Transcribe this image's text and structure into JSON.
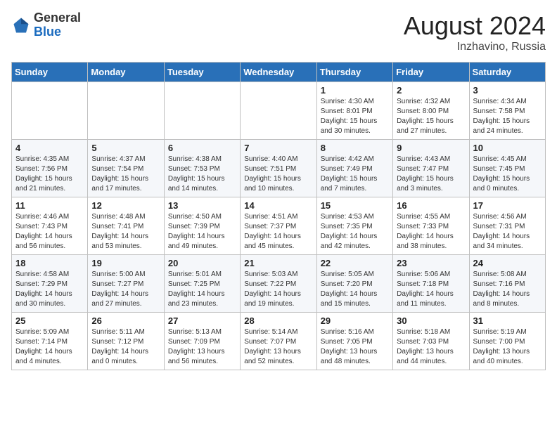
{
  "header": {
    "logo_general": "General",
    "logo_blue": "Blue",
    "month_title": "August 2024",
    "location": "Inzhavino, Russia"
  },
  "days_of_week": [
    "Sunday",
    "Monday",
    "Tuesday",
    "Wednesday",
    "Thursday",
    "Friday",
    "Saturday"
  ],
  "weeks": [
    {
      "days": [
        {
          "num": "",
          "info": ""
        },
        {
          "num": "",
          "info": ""
        },
        {
          "num": "",
          "info": ""
        },
        {
          "num": "",
          "info": ""
        },
        {
          "num": "1",
          "info": "Sunrise: 4:30 AM\nSunset: 8:01 PM\nDaylight: 15 hours\nand 30 minutes."
        },
        {
          "num": "2",
          "info": "Sunrise: 4:32 AM\nSunset: 8:00 PM\nDaylight: 15 hours\nand 27 minutes."
        },
        {
          "num": "3",
          "info": "Sunrise: 4:34 AM\nSunset: 7:58 PM\nDaylight: 15 hours\nand 24 minutes."
        }
      ]
    },
    {
      "days": [
        {
          "num": "4",
          "info": "Sunrise: 4:35 AM\nSunset: 7:56 PM\nDaylight: 15 hours\nand 21 minutes."
        },
        {
          "num": "5",
          "info": "Sunrise: 4:37 AM\nSunset: 7:54 PM\nDaylight: 15 hours\nand 17 minutes."
        },
        {
          "num": "6",
          "info": "Sunrise: 4:38 AM\nSunset: 7:53 PM\nDaylight: 15 hours\nand 14 minutes."
        },
        {
          "num": "7",
          "info": "Sunrise: 4:40 AM\nSunset: 7:51 PM\nDaylight: 15 hours\nand 10 minutes."
        },
        {
          "num": "8",
          "info": "Sunrise: 4:42 AM\nSunset: 7:49 PM\nDaylight: 15 hours\nand 7 minutes."
        },
        {
          "num": "9",
          "info": "Sunrise: 4:43 AM\nSunset: 7:47 PM\nDaylight: 15 hours\nand 3 minutes."
        },
        {
          "num": "10",
          "info": "Sunrise: 4:45 AM\nSunset: 7:45 PM\nDaylight: 15 hours\nand 0 minutes."
        }
      ]
    },
    {
      "days": [
        {
          "num": "11",
          "info": "Sunrise: 4:46 AM\nSunset: 7:43 PM\nDaylight: 14 hours\nand 56 minutes."
        },
        {
          "num": "12",
          "info": "Sunrise: 4:48 AM\nSunset: 7:41 PM\nDaylight: 14 hours\nand 53 minutes."
        },
        {
          "num": "13",
          "info": "Sunrise: 4:50 AM\nSunset: 7:39 PM\nDaylight: 14 hours\nand 49 minutes."
        },
        {
          "num": "14",
          "info": "Sunrise: 4:51 AM\nSunset: 7:37 PM\nDaylight: 14 hours\nand 45 minutes."
        },
        {
          "num": "15",
          "info": "Sunrise: 4:53 AM\nSunset: 7:35 PM\nDaylight: 14 hours\nand 42 minutes."
        },
        {
          "num": "16",
          "info": "Sunrise: 4:55 AM\nSunset: 7:33 PM\nDaylight: 14 hours\nand 38 minutes."
        },
        {
          "num": "17",
          "info": "Sunrise: 4:56 AM\nSunset: 7:31 PM\nDaylight: 14 hours\nand 34 minutes."
        }
      ]
    },
    {
      "days": [
        {
          "num": "18",
          "info": "Sunrise: 4:58 AM\nSunset: 7:29 PM\nDaylight: 14 hours\nand 30 minutes."
        },
        {
          "num": "19",
          "info": "Sunrise: 5:00 AM\nSunset: 7:27 PM\nDaylight: 14 hours\nand 27 minutes."
        },
        {
          "num": "20",
          "info": "Sunrise: 5:01 AM\nSunset: 7:25 PM\nDaylight: 14 hours\nand 23 minutes."
        },
        {
          "num": "21",
          "info": "Sunrise: 5:03 AM\nSunset: 7:22 PM\nDaylight: 14 hours\nand 19 minutes."
        },
        {
          "num": "22",
          "info": "Sunrise: 5:05 AM\nSunset: 7:20 PM\nDaylight: 14 hours\nand 15 minutes."
        },
        {
          "num": "23",
          "info": "Sunrise: 5:06 AM\nSunset: 7:18 PM\nDaylight: 14 hours\nand 11 minutes."
        },
        {
          "num": "24",
          "info": "Sunrise: 5:08 AM\nSunset: 7:16 PM\nDaylight: 14 hours\nand 8 minutes."
        }
      ]
    },
    {
      "days": [
        {
          "num": "25",
          "info": "Sunrise: 5:09 AM\nSunset: 7:14 PM\nDaylight: 14 hours\nand 4 minutes."
        },
        {
          "num": "26",
          "info": "Sunrise: 5:11 AM\nSunset: 7:12 PM\nDaylight: 14 hours\nand 0 minutes."
        },
        {
          "num": "27",
          "info": "Sunrise: 5:13 AM\nSunset: 7:09 PM\nDaylight: 13 hours\nand 56 minutes."
        },
        {
          "num": "28",
          "info": "Sunrise: 5:14 AM\nSunset: 7:07 PM\nDaylight: 13 hours\nand 52 minutes."
        },
        {
          "num": "29",
          "info": "Sunrise: 5:16 AM\nSunset: 7:05 PM\nDaylight: 13 hours\nand 48 minutes."
        },
        {
          "num": "30",
          "info": "Sunrise: 5:18 AM\nSunset: 7:03 PM\nDaylight: 13 hours\nand 44 minutes."
        },
        {
          "num": "31",
          "info": "Sunrise: 5:19 AM\nSunset: 7:00 PM\nDaylight: 13 hours\nand 40 minutes."
        }
      ]
    }
  ]
}
